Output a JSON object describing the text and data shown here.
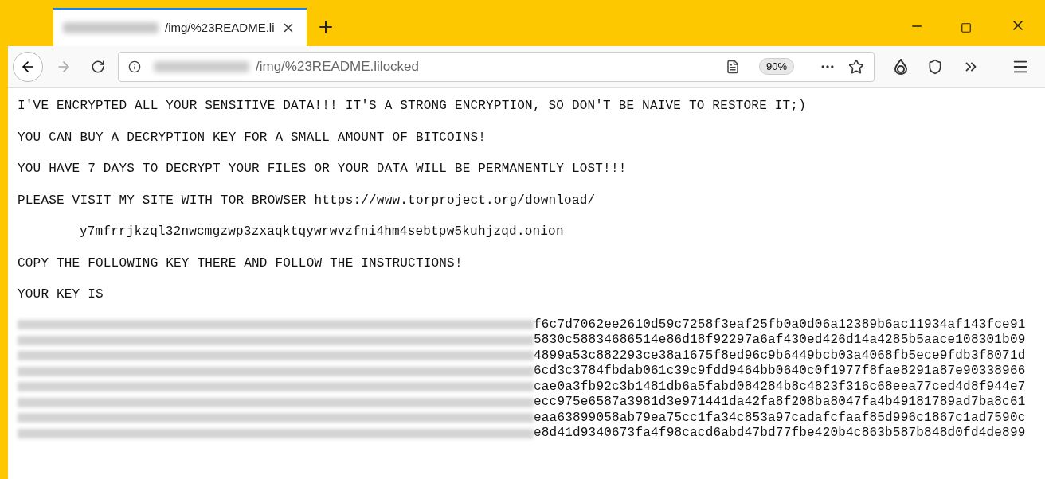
{
  "tab": {
    "title": "/img/%23README.li",
    "selected": true
  },
  "address_bar": {
    "path": "/img/%23README.lilocked",
    "zoom": "90%"
  },
  "note": {
    "paragraphs": [
      {
        "kind": "line",
        "text": "I'VE ENCRYPTED ALL YOUR SENSITIVE DATA!!! IT'S A STRONG ENCRYPTION, SO DON'T BE NAIVE TO RESTORE IT;)"
      },
      {
        "kind": "line",
        "text": "YOU CAN BUY A DECRYPTION KEY FOR A SMALL AMOUNT OF BITCOINS!"
      },
      {
        "kind": "line",
        "text": "YOU HAVE 7 DAYS TO DECRYPT YOUR FILES OR YOUR DATA WILL BE PERMANENTLY LOST!!!"
      },
      {
        "kind": "line",
        "text": "PLEASE VISIT MY SITE WITH TOR BROWSER https://www.torproject.org/download/"
      },
      {
        "kind": "indented",
        "text": "y7mfrrjkzql32nwcmgzwp3zxaqktqywrwvzfni4hm4sebtpw5kuhjzqd.onion"
      },
      {
        "kind": "line",
        "text": "COPY THE FOLLOWING KEY THERE AND FOLLOW THE INSTRUCTIONS!"
      },
      {
        "kind": "line",
        "text": "YOUR KEY IS"
      }
    ],
    "key_lines": [
      "f6c7d7062ee2610d59c7258f3eaf25fb0a0d06a12389b6ac11934af143fce91",
      "5830c58834686514e86d18f92297a6af430ed426d14a4285b5aace108301b09",
      "4899a53c882293ce38a1675f8ed96c9b6449bcb03a4068fb5ece9fdb3f8071d",
      "6cd3c3784fbdab061c39c9fdd9464bb0640c0f1977f8fae8291a87e90338966",
      "cae0a3fb92c3b1481db6a5fabd084284b8c4823f316c68eea77ced4d8f944e7",
      "ecc975e6587a3981d3e971441da42fa8f208ba8047fa4b49181789ad7ba8c61",
      "eaa63899058ab79ea75cc1fa34c853a97cadafcfaaf85d996c1867c1ad7590c",
      "e8d41d9340673fa4f98cacd6abd47bd77fbe420b4c863b587b848d0fd4de899"
    ]
  }
}
